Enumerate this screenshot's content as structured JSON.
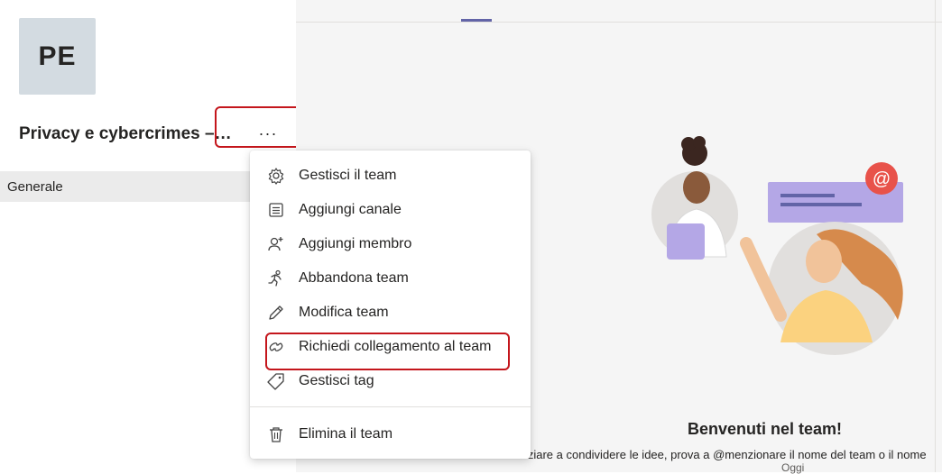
{
  "team": {
    "initials": "PE",
    "name": "Privacy e cybercrimes – ...",
    "more_label": "···"
  },
  "channels": [
    {
      "label": "Generale"
    }
  ],
  "menu": {
    "items": [
      {
        "label": "Gestisci il team",
        "icon": "gear-icon"
      },
      {
        "label": "Aggiungi canale",
        "icon": "channel-list-icon"
      },
      {
        "label": "Aggiungi membro",
        "icon": "add-person-icon"
      },
      {
        "label": "Abbandona team",
        "icon": "leave-running-icon"
      },
      {
        "label": "Modifica team",
        "icon": "pencil-icon"
      },
      {
        "label": "Richiedi collegamento al team",
        "icon": "link-icon"
      },
      {
        "label": "Gestisci tag",
        "icon": "tag-icon"
      },
      {
        "label": "Elimina il team",
        "icon": "trash-icon"
      }
    ]
  },
  "welcome": {
    "title": "Benvenuti nel team!",
    "subtitle": "Per iniziare a condividere le idee, prova a @menzionare il nome del team o il nome",
    "today": "Oggi"
  },
  "colors": {
    "accent": "#6264a7",
    "highlight": "#c4161c",
    "mention": "#e8524a"
  }
}
